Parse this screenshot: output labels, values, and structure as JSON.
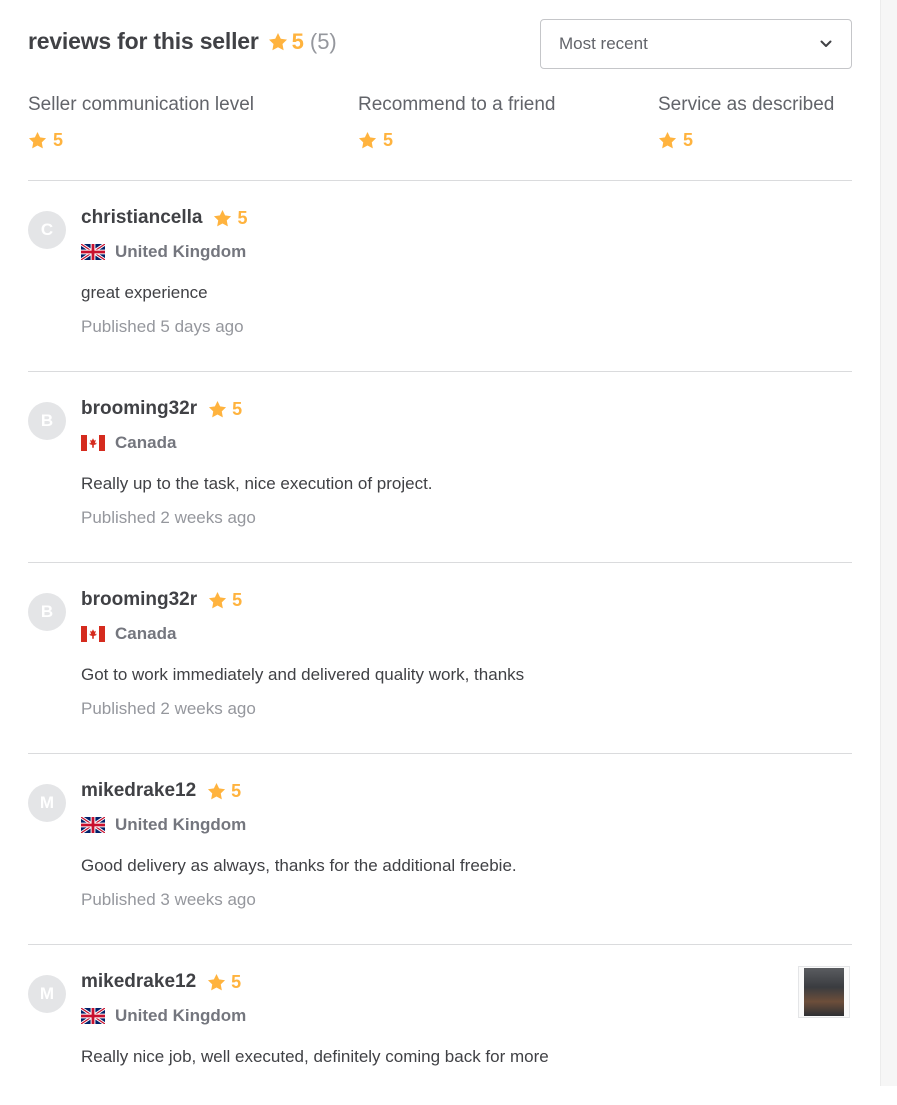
{
  "header": {
    "title": "reviews for this seller",
    "rating": "5",
    "count": "(5)"
  },
  "sort": {
    "selected": "Most recent"
  },
  "breakdown": [
    {
      "label": "Seller communication level",
      "value": "5"
    },
    {
      "label": "Recommend to a friend",
      "value": "5"
    },
    {
      "label": "Service as described",
      "value": "5"
    }
  ],
  "reviews": [
    {
      "initial": "C",
      "username": "christiancella",
      "rating": "5",
      "country": "United Kingdom",
      "flag": "uk-flag",
      "text": "great experience",
      "date": "Published 5 days ago"
    },
    {
      "initial": "B",
      "username": "brooming32r",
      "rating": "5",
      "country": "Canada",
      "flag": "canada-flag",
      "text": "Really up to the task, nice execution of project.",
      "date": "Published 2 weeks ago"
    },
    {
      "initial": "B",
      "username": "brooming32r",
      "rating": "5",
      "country": "Canada",
      "flag": "canada-flag",
      "text": "Got to work immediately and delivered quality work, thanks",
      "date": "Published 2 weeks ago"
    },
    {
      "initial": "M",
      "username": "mikedrake12",
      "rating": "5",
      "country": "United Kingdom",
      "flag": "uk-flag",
      "text": "Good delivery as always, thanks for the additional freebie.",
      "date": "Published 3 weeks ago"
    },
    {
      "initial": "M",
      "username": "mikedrake12",
      "rating": "5",
      "country": "United Kingdom",
      "flag": "uk-flag",
      "text": "Really nice job, well executed, definitely coming back for more",
      "date": ""
    }
  ],
  "colors": {
    "star": "#ffb33e",
    "text": "#404145",
    "muted": "#95979d",
    "divider": "#dadbdd"
  }
}
